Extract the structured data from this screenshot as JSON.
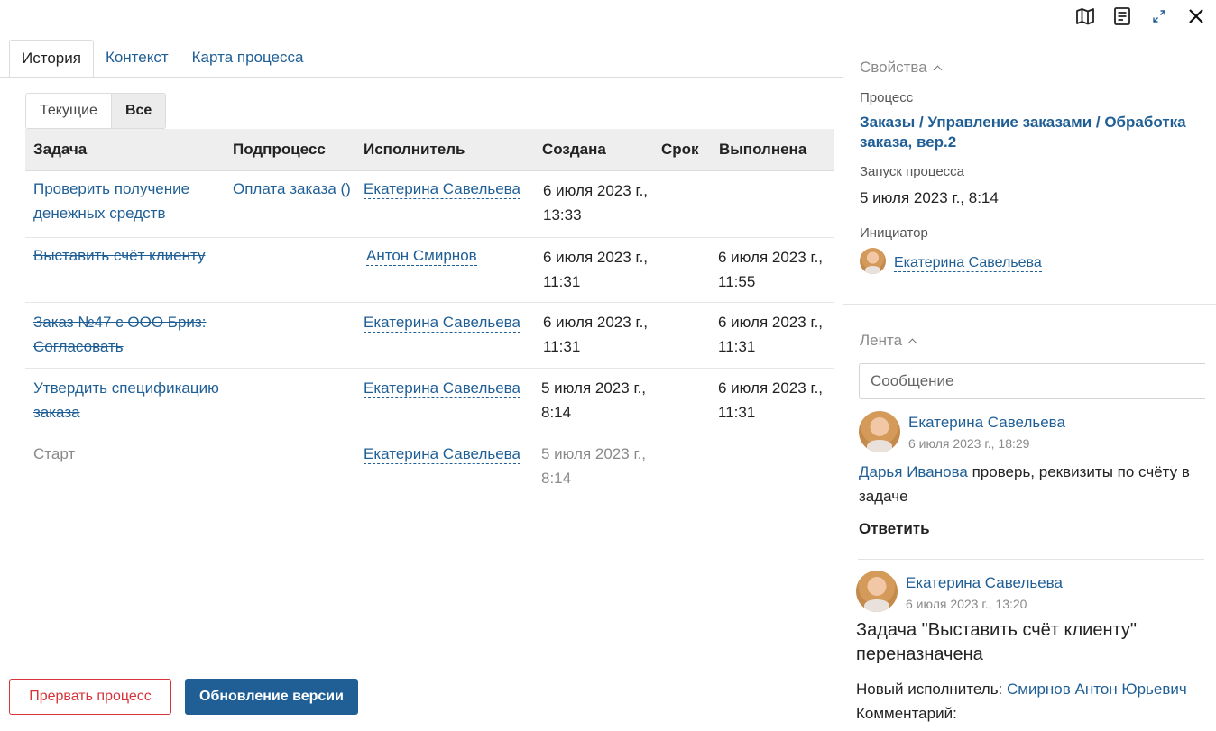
{
  "window_icons": {
    "map": "map-icon",
    "document": "document-icon",
    "expand": "expand-icon",
    "close": "close-icon"
  },
  "tabs": [
    {
      "label": "История",
      "active": true
    },
    {
      "label": "Контекст",
      "active": false
    },
    {
      "label": "Карта процесса",
      "active": false
    }
  ],
  "filter": {
    "current": "Текущие",
    "all": "Все"
  },
  "table": {
    "headers": {
      "task": "Задача",
      "subprocess": "Подпроцесс",
      "executor": "Исполнитель",
      "created": "Создана",
      "deadline": "Срок",
      "done": "Выполнена"
    },
    "rows": [
      {
        "task": "Проверить получение денежных средств",
        "subprocess": "Оплата заказа ()",
        "executor": "Екатерина Савельева",
        "created": "6 июля 2023 г., 13:33",
        "deadline": "",
        "done": ""
      },
      {
        "task": "Выставить счёт клиенту",
        "subprocess": "",
        "executor": "Антон Смирнов",
        "created": "6 июля 2023 г., 11:31",
        "deadline": "",
        "done": "6 июля 2023 г., 11:55"
      },
      {
        "task": "Заказ №47 с ООО Бриз: Согласовать",
        "subprocess": "",
        "executor": "Екатерина Савельева",
        "created": "6 июля 2023 г., 11:31",
        "deadline": "",
        "done": "6 июля 2023 г., 11:31"
      },
      {
        "task": "Утвердить спецификацию заказа",
        "subprocess": "",
        "executor": "Екатерина Савельева",
        "created": "5 июля 2023 г., 8:14",
        "deadline": "",
        "done": "6 июля 2023 г., 11:31"
      },
      {
        "task": "Старт",
        "subprocess": "",
        "executor": "Екатерина Савельева",
        "created": "5 июля 2023 г., 8:14",
        "deadline": "",
        "done": ""
      }
    ]
  },
  "actions": {
    "abort": "Прервать процесс",
    "update": "Обновление версии"
  },
  "properties": {
    "title": "Свойства",
    "process_label": "Процесс",
    "process_value": "Заказы / Управление заказами / Обработка заказа, вер.2",
    "launch_label": "Запуск процесса",
    "launch_value": "5 июля 2023 г., 8:14",
    "initiator_label": "Инициатор",
    "initiator_value": "Екатерина Савельева"
  },
  "feed": {
    "title": "Лента",
    "placeholder": "Сообщение",
    "entries": [
      {
        "author": "Екатерина Савельева",
        "time": "6 июля 2023 г., 18:29",
        "mention": "Дарья Иванова",
        "text_after_mention": " проверь, реквизиты по счёту в задаче",
        "reply": "Ответить"
      },
      {
        "author": "Екатерина Савельева",
        "time": "6 июля 2023 г., 13:20",
        "heading": "Задача \"Выставить счёт клиенту\" переназначена",
        "new_executor_label": "Новый исполнитель: ",
        "new_executor_value": "Смирнов Антон Юрьевич",
        "comment_label": "Комментарий:"
      }
    ]
  }
}
